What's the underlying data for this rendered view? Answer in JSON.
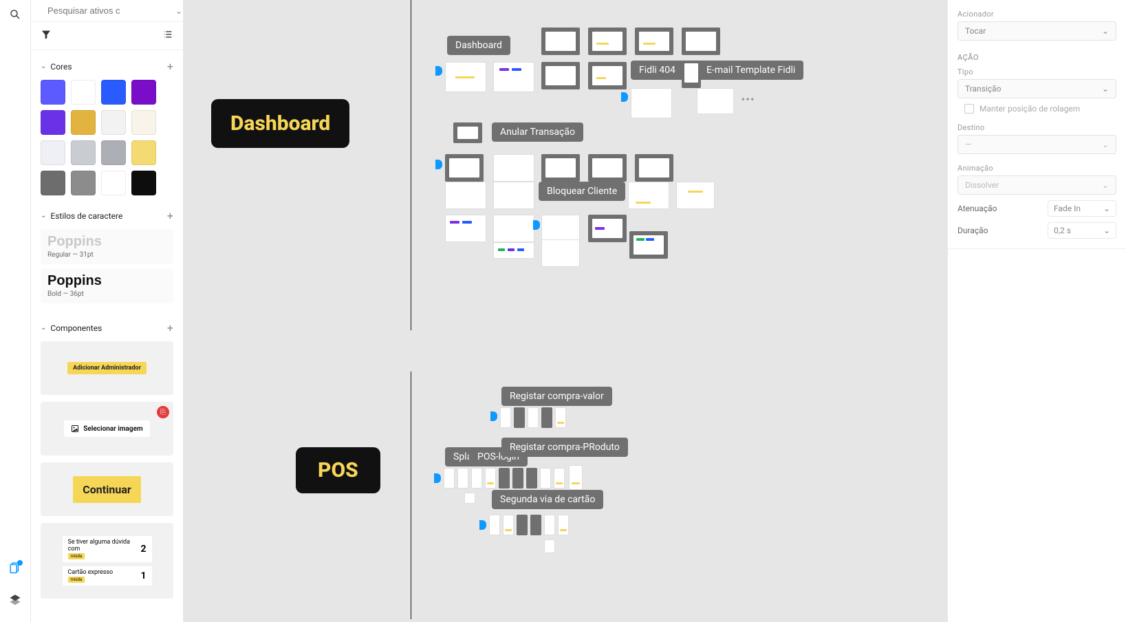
{
  "search": {
    "placeholder": "Pesquisar ativos c"
  },
  "sections": {
    "colors": {
      "title": "Cores",
      "swatches": [
        "#5b5bff",
        "#ffffff",
        "#2a5bff",
        "#7a0dc7",
        "#6a32e6",
        "#e2b33e",
        "#f2f2f2",
        "#f8f4ea",
        "#eef0f5",
        "#c9ccd2",
        "#acafb6",
        "#f3da73",
        "#6d6d6d",
        "#8c8c8c",
        "#ffffff",
        "#0d0d0d"
      ]
    },
    "textstyles": {
      "title": "Estilos de caractere",
      "items": [
        {
          "name": "Poppins",
          "meta": "Regular — 31pt",
          "variant": "light"
        },
        {
          "name": "Poppins",
          "meta": "Bold — 36pt",
          "variant": "bold"
        }
      ]
    },
    "components": {
      "title": "Componentes",
      "c1": "Adicionar Administrador",
      "c2": "Selecionar imagem",
      "c3": "Continuar",
      "c4_line1": "Se tiver alguma dúvida com",
      "c4_line2": "Cartão expresso"
    }
  },
  "canvas": {
    "label_dashboard": "Dashboard",
    "label_pos": "POS",
    "frames": {
      "dashboard": "Dashboard",
      "fidli404": "Fidli 404",
      "email": "E-mail Template Fidli",
      "anular": "Anular Transação",
      "bloquear": "Bloquear Cliente",
      "reg_valor": "Registar compra-valor",
      "reg_produto": "Registar compra-PRoduto",
      "splash": "Spla",
      "poslogin": "POS-login",
      "segunda": "Segunda via de cartão"
    }
  },
  "inspector": {
    "trigger_label": "Acionador",
    "trigger_value": "Tocar",
    "action_header": "AÇÃO",
    "type_label": "Tipo",
    "type_value": "Transição",
    "keep_scroll": "Manter posição de rolagem",
    "dest_label": "Destino",
    "dest_value": "—",
    "anim_label": "Animação",
    "anim_value": "Dissolver",
    "ease_label": "Atenuação",
    "ease_value": "Fade In",
    "dur_label": "Duração",
    "dur_value": "0,2 s"
  }
}
